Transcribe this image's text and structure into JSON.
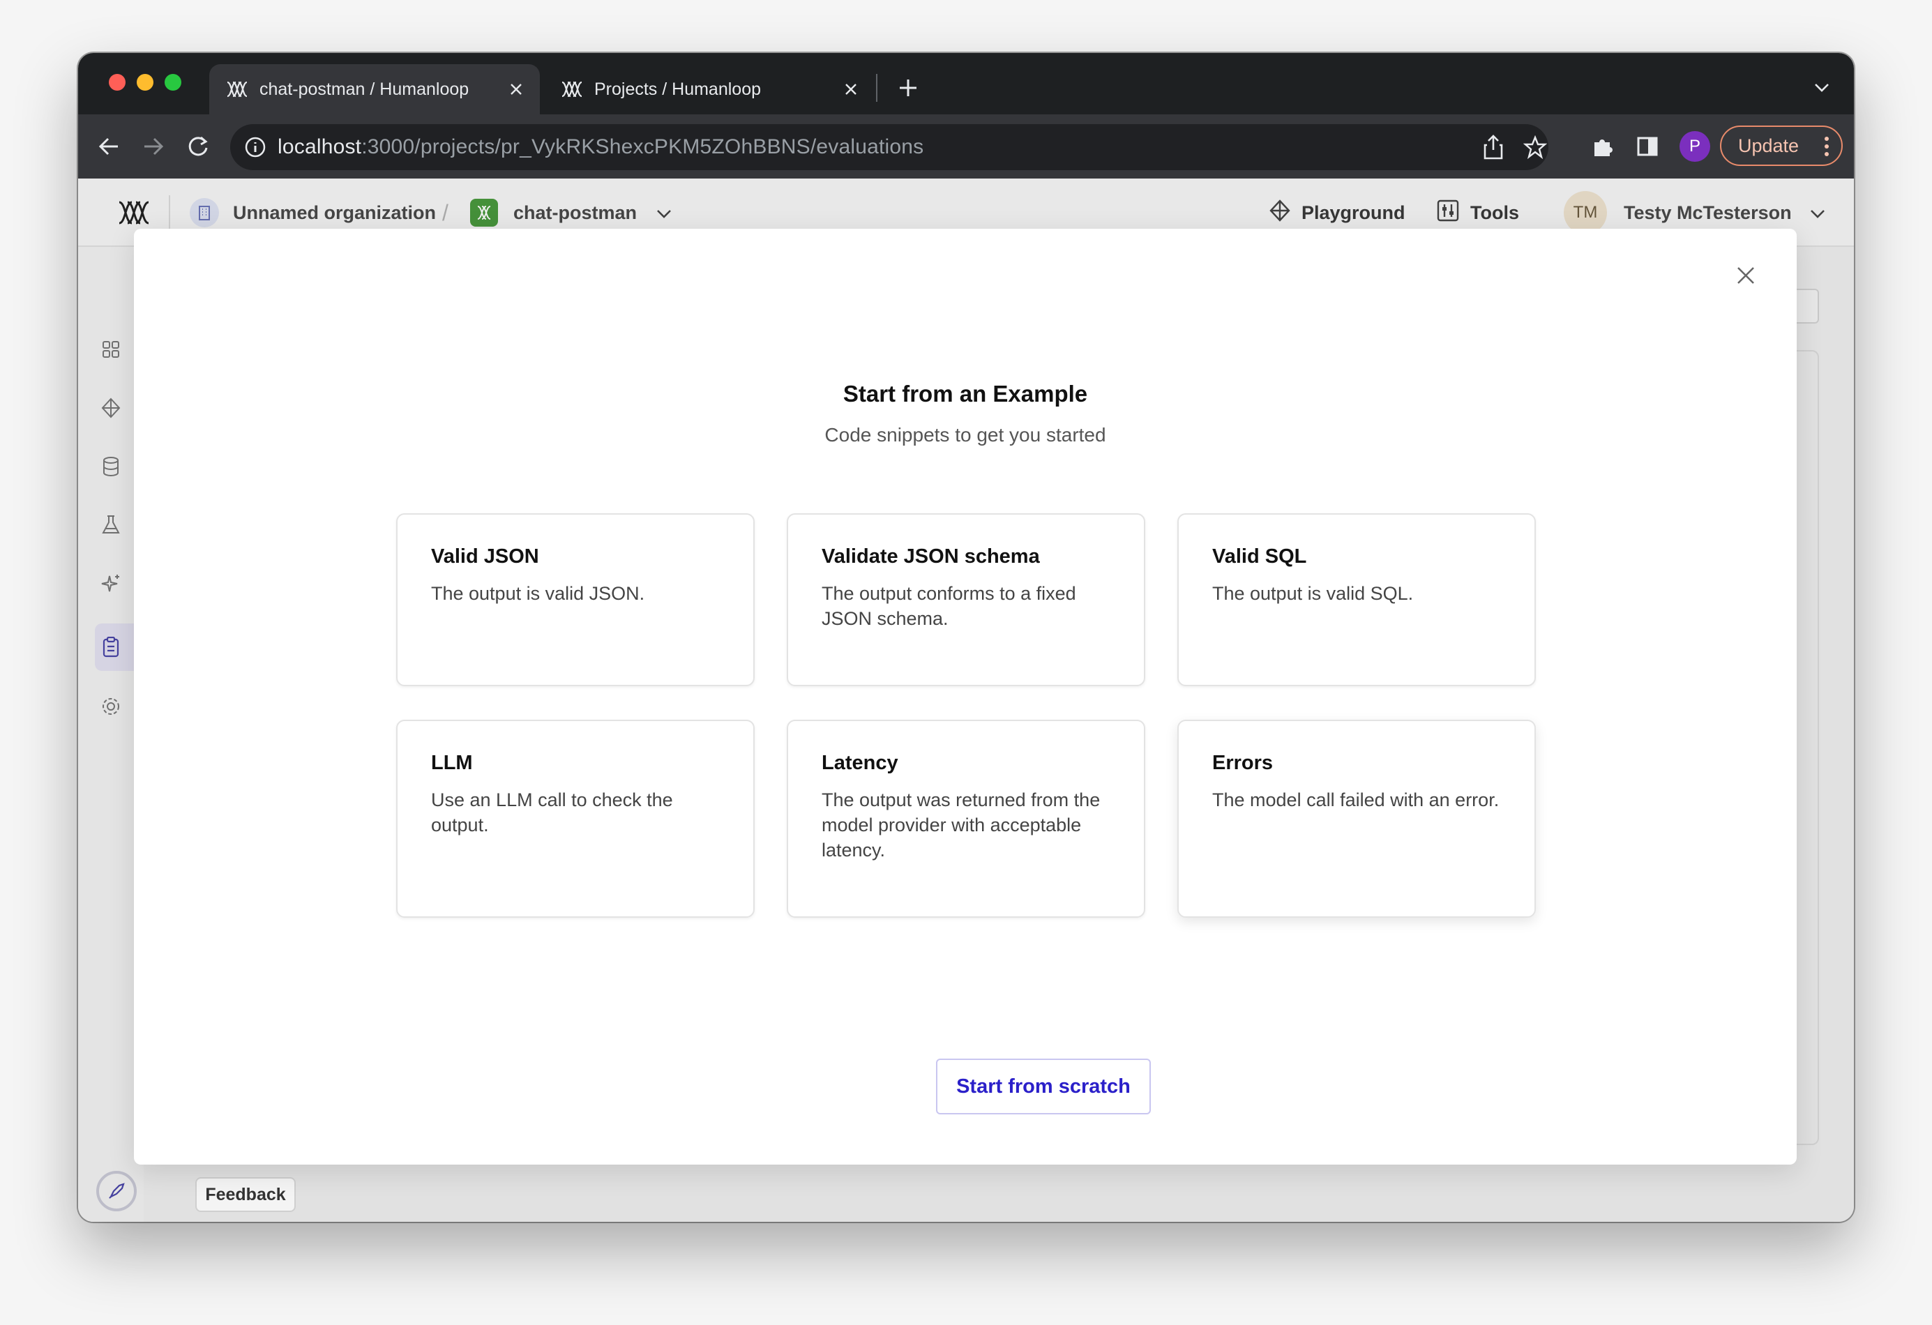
{
  "browser": {
    "tabs": [
      {
        "label": "chat-postman / Humanloop",
        "active": true
      },
      {
        "label": "Projects / Humanloop",
        "active": false
      }
    ],
    "url_host": "localhost",
    "url_path": ":3000/projects/pr_VykRKShexcPKM5ZOhBBNS/evaluations",
    "profile_initial": "P",
    "update_label": "Update"
  },
  "header": {
    "organization": "Unnamed organization",
    "separator": "/",
    "project": "chat-postman",
    "playground_label": "Playground",
    "tools_label": "Tools",
    "user_initials": "TM",
    "user_name": "Testy McTesterson"
  },
  "sidebar": {
    "items": [
      "grid-icon",
      "diamond-icon",
      "database-icon",
      "flask-icon",
      "sparkle-icon",
      "clipboard-icon",
      "gear-icon"
    ],
    "active_item": "clipboard-icon"
  },
  "footer": {
    "feedback_label": "Feedback"
  },
  "modal": {
    "title": "Start from an Example",
    "subtitle": "Code snippets to get you started",
    "cards": [
      {
        "title": "Valid JSON",
        "description": "The output is valid JSON."
      },
      {
        "title": "Validate JSON schema",
        "description": "The output conforms to a fixed JSON schema."
      },
      {
        "title": "Valid SQL",
        "description": "The output is valid SQL."
      },
      {
        "title": "LLM",
        "description": "Use an LLM call to check the output."
      },
      {
        "title": "Latency",
        "description": "The output was returned from the model provider with acceptable latency."
      },
      {
        "title": "Errors",
        "description": "The model call failed with an error."
      }
    ],
    "scratch_button": "Start from scratch"
  },
  "colors": {
    "accent": "#2b20c9",
    "tab_strip": "#1e2022",
    "toolbar": "#35363a",
    "profile": "#7b2fbe"
  }
}
